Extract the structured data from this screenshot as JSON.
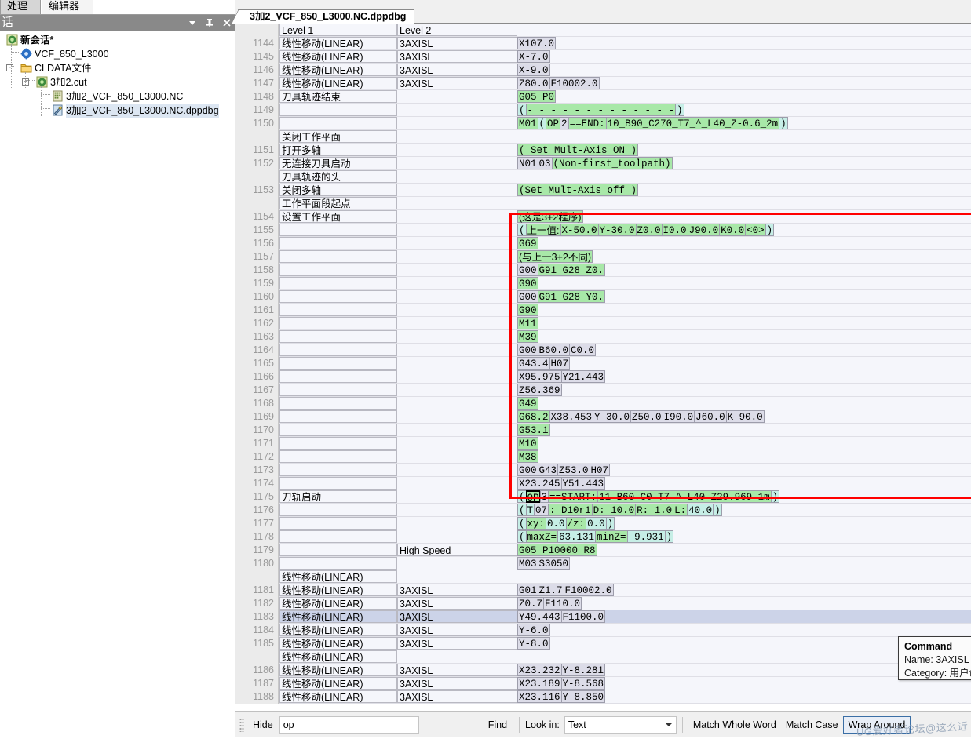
{
  "left_panel": {
    "tabs": [
      {
        "id": "processor",
        "label": "处理器"
      },
      {
        "id": "editor",
        "label": "编辑器"
      }
    ],
    "caption": "话",
    "caption_buttons": [
      {
        "name": "dropdown-icon",
        "glyph": "▼"
      },
      {
        "name": "pin-icon",
        "glyph": "⊥"
      },
      {
        "name": "close-icon",
        "glyph": "✕"
      }
    ],
    "tree": [
      {
        "label": "新会话*",
        "icon": "session-icon",
        "depth": 0,
        "bold": true,
        "expander": "",
        "selected": false
      },
      {
        "label": "VCF_850_L3000",
        "icon": "gear-icon",
        "depth": 1,
        "bold": false,
        "expander": "",
        "selected": false
      },
      {
        "label": "CLDATA文件",
        "icon": "folder-icon",
        "depth": 1,
        "bold": false,
        "expander": "-",
        "selected": false
      },
      {
        "label": "3加2.cut",
        "icon": "session-icon",
        "depth": 2,
        "bold": false,
        "expander": "-",
        "selected": false
      },
      {
        "label": "3加2_VCF_850_L3000.NC",
        "icon": "nc-file-icon",
        "depth": 3,
        "bold": false,
        "expander": "",
        "selected": false
      },
      {
        "label": "3加2_VCF_850_L3000.NC.dppdbg",
        "icon": "dbg-file-icon",
        "depth": 3,
        "bold": false,
        "expander": "",
        "selected": true
      }
    ]
  },
  "main": {
    "document_tab": "3加2_VCF_850_L3000.NC.dppdbg",
    "headers": {
      "level1": "Level 1",
      "level2": "Level 2"
    },
    "rows": [
      {
        "no": "",
        "l1": "Level 1",
        "l2": "Level 2",
        "header": true,
        "code": []
      },
      {
        "no": "1144",
        "l1": "线性移动(LINEAR)",
        "l2": "3AXISL",
        "code": [
          {
            "t": "X107.0",
            "s": "v"
          }
        ]
      },
      {
        "no": "1145",
        "l1": "线性移动(LINEAR)",
        "l2": "3AXISL",
        "code": [
          {
            "t": "X-7.0",
            "s": "v"
          }
        ]
      },
      {
        "no": "1146",
        "l1": "线性移动(LINEAR)",
        "l2": "3AXISL",
        "code": [
          {
            "t": "X-9.0",
            "s": "v"
          }
        ]
      },
      {
        "no": "1147",
        "l1": "线性移动(LINEAR)",
        "l2": "3AXISL",
        "code": [
          {
            "t": "Z80.0",
            "s": "v"
          },
          {
            "t": "F10002.0",
            "s": "v"
          }
        ]
      },
      {
        "no": "1148",
        "l1": "刀具轨迹结束",
        "l2": "",
        "code": [
          {
            "t": "G05 P0",
            "s": "g"
          }
        ]
      },
      {
        "no": "1149",
        "l1": "",
        "l2": "",
        "code": [
          {
            "t": "(",
            "s": "c"
          },
          {
            "t": "- - - - - - - - - - - - -",
            "s": "g"
          },
          {
            "t": ")",
            "s": "c"
          }
        ]
      },
      {
        "no": "1150",
        "l1": "",
        "l2": "",
        "code": [
          {
            "t": "M01",
            "s": "g"
          },
          {
            "t": "(",
            "s": "c"
          },
          {
            "t": "OP",
            "s": "g"
          },
          {
            "t": "2",
            "s": "v"
          },
          {
            "t": "==END:",
            "s": "g"
          },
          {
            "t": "10_B90_C270_T7_^_L40_Z-0.6_2m",
            "s": "g"
          },
          {
            "t": ")",
            "s": "c"
          }
        ]
      },
      {
        "no": "",
        "l1": "关闭工作平面",
        "l2": "",
        "code": []
      },
      {
        "no": "1151",
        "l1": "打开多轴",
        "l2": "",
        "code": [
          {
            "t": "( Set Mult-Axis ON )",
            "s": "g"
          }
        ]
      },
      {
        "no": "1152",
        "l1": "无连接刀具启动",
        "l2": "",
        "code": [
          {
            "t": "N01",
            "s": "v"
          },
          {
            "t": "03",
            "s": "v"
          },
          {
            "t": "(Non-first_toolpath)",
            "s": "g"
          }
        ]
      },
      {
        "no": "",
        "l1": "刀具轨迹的头",
        "l2": "",
        "code": []
      },
      {
        "no": "1153",
        "l1": "关闭多轴",
        "l2": "",
        "code": [
          {
            "t": "(Set Mult-Axis off )",
            "s": "g"
          }
        ]
      },
      {
        "no": "",
        "l1": "工作平面段起点",
        "l2": "",
        "code": []
      },
      {
        "no": "1154",
        "l1": "设置工作平面",
        "l2": "",
        "code": [
          {
            "t": "(这是3+2程序)",
            "s": "g",
            "cn": true
          }
        ]
      },
      {
        "no": "1155",
        "l1": "",
        "l2": "",
        "code": [
          {
            "t": "(",
            "s": "c"
          },
          {
            "t": "上一值:",
            "s": "g",
            "cn": true
          },
          {
            "t": "X-50.0",
            "s": "g"
          },
          {
            "t": "Y-30.0",
            "s": "g"
          },
          {
            "t": "Z0.0",
            "s": "g"
          },
          {
            "t": "I0.0",
            "s": "g"
          },
          {
            "t": "J90.0",
            "s": "g"
          },
          {
            "t": "K0.0",
            "s": "g"
          },
          {
            "t": "<0>",
            "s": "g"
          },
          {
            "t": ")",
            "s": "c"
          }
        ]
      },
      {
        "no": "1156",
        "l1": "",
        "l2": "",
        "code": [
          {
            "t": "G69",
            "s": "g"
          }
        ]
      },
      {
        "no": "1157",
        "l1": "",
        "l2": "",
        "code": [
          {
            "t": "(与上一3+2不同)",
            "s": "g",
            "cn": true
          }
        ]
      },
      {
        "no": "1158",
        "l1": "",
        "l2": "",
        "code": [
          {
            "t": "G00",
            "s": "v"
          },
          {
            "t": "G91 G28 Z0.",
            "s": "g"
          }
        ]
      },
      {
        "no": "1159",
        "l1": "",
        "l2": "",
        "code": [
          {
            "t": "G90",
            "s": "g"
          }
        ]
      },
      {
        "no": "1160",
        "l1": "",
        "l2": "",
        "code": [
          {
            "t": "G00",
            "s": "v"
          },
          {
            "t": "G91 G28 Y0.",
            "s": "g"
          }
        ]
      },
      {
        "no": "1161",
        "l1": "",
        "l2": "",
        "code": [
          {
            "t": "G90",
            "s": "g"
          }
        ]
      },
      {
        "no": "1162",
        "l1": "",
        "l2": "",
        "code": [
          {
            "t": "M11",
            "s": "g"
          }
        ]
      },
      {
        "no": "1163",
        "l1": "",
        "l2": "",
        "code": [
          {
            "t": "M39",
            "s": "g"
          }
        ]
      },
      {
        "no": "1164",
        "l1": "",
        "l2": "",
        "code": [
          {
            "t": "G00",
            "s": "v"
          },
          {
            "t": "B60.0",
            "s": "v"
          },
          {
            "t": "C0.0",
            "s": "v"
          }
        ]
      },
      {
        "no": "1165",
        "l1": "",
        "l2": "",
        "code": [
          {
            "t": "G43.4",
            "s": "v"
          },
          {
            "t": "H07",
            "s": "v"
          }
        ]
      },
      {
        "no": "1166",
        "l1": "",
        "l2": "",
        "code": [
          {
            "t": "X95.975",
            "s": "v"
          },
          {
            "t": "Y21.443",
            "s": "v"
          }
        ]
      },
      {
        "no": "1167",
        "l1": "",
        "l2": "",
        "code": [
          {
            "t": "Z56.369",
            "s": "v"
          }
        ]
      },
      {
        "no": "1168",
        "l1": "",
        "l2": "",
        "code": [
          {
            "t": "G49",
            "s": "g"
          }
        ]
      },
      {
        "no": "1169",
        "l1": "",
        "l2": "",
        "code": [
          {
            "t": "G68.2",
            "s": "g"
          },
          {
            "t": "X38.453",
            "s": "v"
          },
          {
            "t": "Y-30.0",
            "s": "v"
          },
          {
            "t": "Z50.0",
            "s": "v"
          },
          {
            "t": "I90.0",
            "s": "v"
          },
          {
            "t": "J60.0",
            "s": "v"
          },
          {
            "t": "K-90.0",
            "s": "v"
          }
        ]
      },
      {
        "no": "1170",
        "l1": "",
        "l2": "",
        "code": [
          {
            "t": "G53.1",
            "s": "g"
          }
        ]
      },
      {
        "no": "1171",
        "l1": "",
        "l2": "",
        "code": [
          {
            "t": "M10",
            "s": "g"
          }
        ]
      },
      {
        "no": "1172",
        "l1": "",
        "l2": "",
        "code": [
          {
            "t": "M38",
            "s": "g"
          }
        ]
      },
      {
        "no": "1173",
        "l1": "",
        "l2": "",
        "code": [
          {
            "t": "G00",
            "s": "v"
          },
          {
            "t": "G43",
            "s": "v"
          },
          {
            "t": "Z53.0",
            "s": "v"
          },
          {
            "t": "H07",
            "s": "v"
          }
        ]
      },
      {
        "no": "1174",
        "l1": "",
        "l2": "",
        "code": [
          {
            "t": "X23.245",
            "s": "v"
          },
          {
            "t": "Y51.443",
            "s": "v"
          }
        ]
      },
      {
        "no": "1175",
        "l1": "刀轨启动",
        "l2": "",
        "code": [
          {
            "t": "(",
            "s": "c"
          },
          {
            "t": "OP",
            "s": "g",
            "match": true
          },
          {
            "t": "3",
            "s": "v"
          },
          {
            "t": "==START:",
            "s": "g"
          },
          {
            "t": "11_B60_C0_T7_^_L40_Z29.969_1m",
            "s": "g"
          },
          {
            "t": ")",
            "s": "c"
          }
        ]
      },
      {
        "no": "1176",
        "l1": "",
        "l2": "",
        "code": [
          {
            "t": "(",
            "s": "c"
          },
          {
            "t": "T",
            "s": "c"
          },
          {
            "t": "07",
            "s": "v"
          },
          {
            "t": ": D10r1",
            "s": "g"
          },
          {
            "t": "D: 10.0",
            "s": "g"
          },
          {
            "t": "R: 1.0",
            "s": "g"
          },
          {
            "t": "L:",
            "s": "g"
          },
          {
            "t": "40.0",
            "s": "c"
          },
          {
            "t": ")",
            "s": "c"
          }
        ]
      },
      {
        "no": "1177",
        "l1": "",
        "l2": "",
        "code": [
          {
            "t": "(",
            "s": "c"
          },
          {
            "t": "xy:",
            "s": "g"
          },
          {
            "t": "0.0",
            "s": "c"
          },
          {
            "t": "/z:",
            "s": "g"
          },
          {
            "t": "0.0",
            "s": "c"
          },
          {
            "t": ")",
            "s": "c"
          }
        ]
      },
      {
        "no": "1178",
        "l1": "",
        "l2": "",
        "code": [
          {
            "t": "(",
            "s": "c"
          },
          {
            "t": "maxZ=",
            "s": "g"
          },
          {
            "t": "63.131",
            "s": "c"
          },
          {
            "t": "minZ=",
            "s": "g"
          },
          {
            "t": "-9.931",
            "s": "c"
          },
          {
            "t": ")",
            "s": "c"
          }
        ]
      },
      {
        "no": "1179",
        "l1": "",
        "l2": "High Speed",
        "code": [
          {
            "t": "G05 P10000 R8",
            "s": "g"
          }
        ]
      },
      {
        "no": "1180",
        "l1": "",
        "l2": "",
        "code": [
          {
            "t": "M03",
            "s": "v"
          },
          {
            "t": "S3050",
            "s": "v"
          }
        ]
      },
      {
        "no": "",
        "l1": "线性移动(LINEAR)",
        "l2": "",
        "code": []
      },
      {
        "no": "1181",
        "l1": "线性移动(LINEAR)",
        "l2": "3AXISL",
        "code": [
          {
            "t": "G01",
            "s": "v"
          },
          {
            "t": "Z1.7",
            "s": "v"
          },
          {
            "t": "F10002.0",
            "s": "v"
          }
        ]
      },
      {
        "no": "1182",
        "l1": "线性移动(LINEAR)",
        "l2": "3AXISL",
        "code": [
          {
            "t": "Z0.7",
            "s": "v"
          },
          {
            "t": "F110.0",
            "s": "v"
          }
        ]
      },
      {
        "no": "1183",
        "l1": "线性移动(LINEAR)",
        "l2": "3AXISL",
        "selected": true,
        "code": [
          {
            "t": "Y49.443",
            "s": "v"
          },
          {
            "t": "F1100.0",
            "s": "v"
          }
        ]
      },
      {
        "no": "1184",
        "l1": "线性移动(LINEAR)",
        "l2": "3AXISL",
        "code": [
          {
            "t": "Y-6.0",
            "s": "v"
          }
        ]
      },
      {
        "no": "1185",
        "l1": "线性移动(LINEAR)",
        "l2": "3AXISL",
        "code": [
          {
            "t": "Y-8.0",
            "s": "v"
          }
        ]
      },
      {
        "no": "",
        "l1": "线性移动(LINEAR)",
        "l2": "",
        "code": []
      },
      {
        "no": "1186",
        "l1": "线性移动(LINEAR)",
        "l2": "3AXISL",
        "code": [
          {
            "t": "X23.232",
            "s": "v"
          },
          {
            "t": "Y-8.281",
            "s": "v"
          }
        ]
      },
      {
        "no": "1187",
        "l1": "线性移动(LINEAR)",
        "l2": "3AXISL",
        "code": [
          {
            "t": "X23.189",
            "s": "v"
          },
          {
            "t": "Y-8.568",
            "s": "v"
          }
        ]
      },
      {
        "no": "1188",
        "l1": "线性移动(LINEAR)",
        "l2": "3AXISL",
        "code": [
          {
            "t": "X23.116",
            "s": "v"
          },
          {
            "t": "Y-8.850",
            "s": "v"
          }
        ]
      }
    ]
  },
  "tooltip": {
    "title": "Command",
    "name_row": "Name: 3AXISL",
    "category_row": "Category: 用户命令"
  },
  "findbar": {
    "hide_label": "Hide",
    "search_value": "op",
    "search_placeholder": "",
    "find_label": "Find",
    "lookin_label": "Look in:",
    "lookin_value": "Text",
    "match_whole_word": "Match Whole Word",
    "match_case": "Match Case",
    "wrap_around": "Wrap Around"
  },
  "watermark": "UG爱好者论坛@这么近",
  "colors": {
    "highlight_green": "#a8e8a8",
    "highlight_cyan": "#c6eee6",
    "value_gray": "#dcdce8",
    "selection_blue": "#ccd3e8",
    "redbox": "#ff0000",
    "caption_bar": "#898989",
    "gutter": "#ebebeb",
    "grid_bg": "#f5f6fb"
  }
}
